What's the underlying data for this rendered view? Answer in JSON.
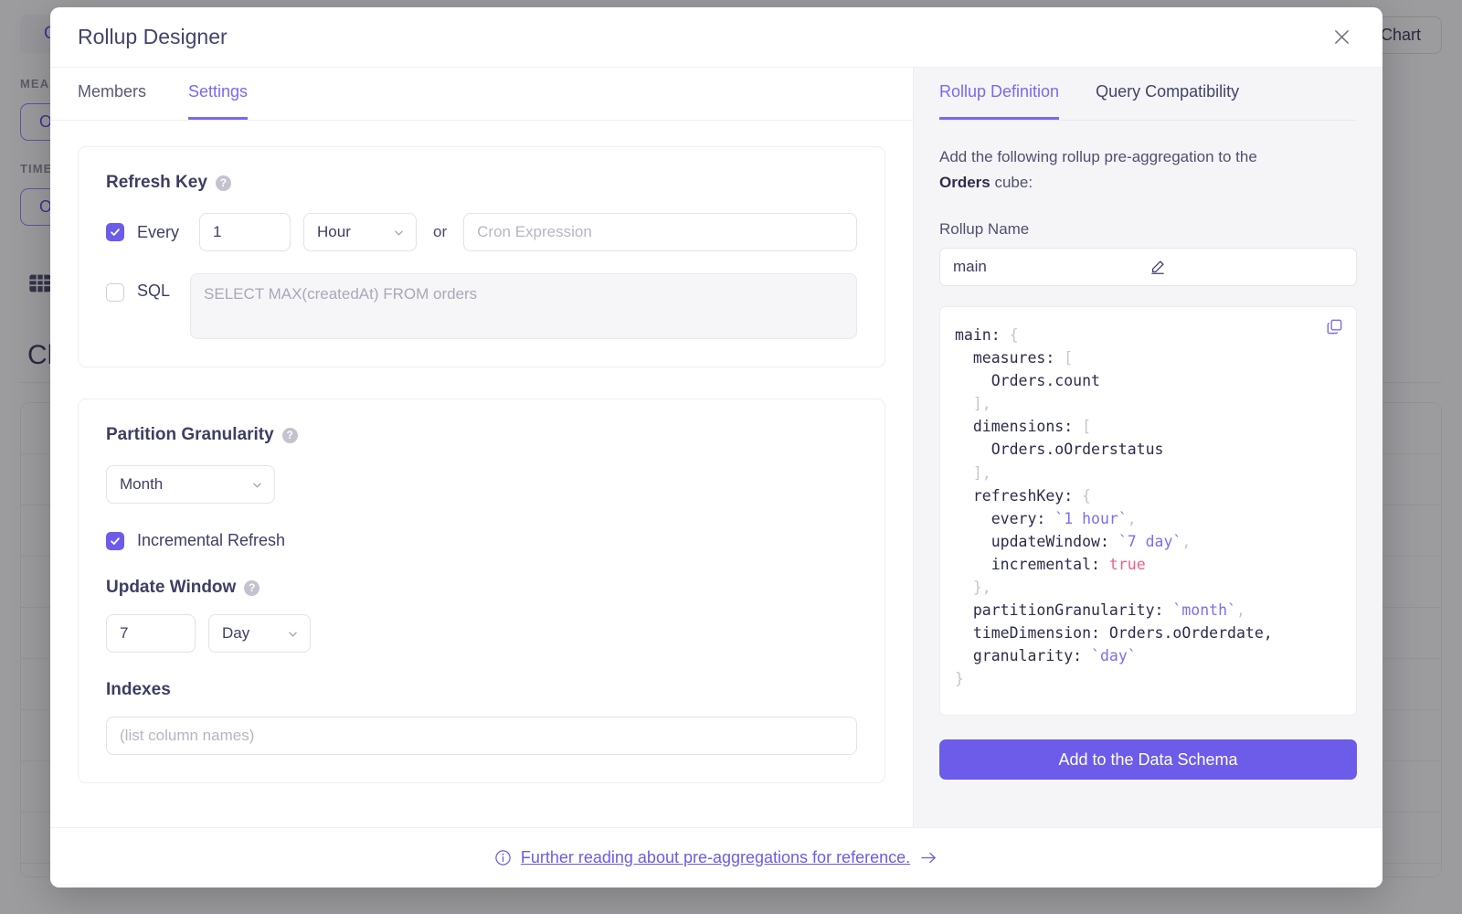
{
  "background": {
    "tab_label": "Query",
    "right_button_label": "Chart",
    "measures_label": "MEASURES",
    "measures_chip": "Orders.count",
    "time_label": "TIME DIMENSION",
    "time_chip": "Orders.oOrderdate",
    "grid_icon": "grid-icon",
    "heading": "Chart"
  },
  "modal": {
    "title": "Rollup Designer",
    "close_icon": "close-icon"
  },
  "left": {
    "tabs": [
      {
        "label": "Members",
        "active": false
      },
      {
        "label": "Settings",
        "active": true
      }
    ],
    "refresh_key": {
      "title": "Refresh Key",
      "help_icon": "help-icon",
      "every": {
        "checked": true,
        "label": "Every",
        "value": "1",
        "unit": "Hour",
        "or_label": "or",
        "cron_placeholder": "Cron Expression",
        "cron_value": ""
      },
      "sql": {
        "checked": false,
        "label": "SQL",
        "placeholder": "SELECT MAX(createdAt) FROM orders",
        "value": ""
      }
    },
    "partition": {
      "title": "Partition Granularity",
      "help_icon": "help-icon",
      "granularity": "Month",
      "incremental": {
        "checked": true,
        "label": "Incremental Refresh"
      },
      "update_window": {
        "title": "Update Window",
        "help_icon": "help-icon",
        "value": "7",
        "unit": "Day"
      },
      "indexes": {
        "title": "Indexes",
        "placeholder": "(list column names)",
        "value": ""
      }
    }
  },
  "right": {
    "tabs": [
      {
        "label": "Rollup Definition",
        "active": true
      },
      {
        "label": "Query Compatibility",
        "active": false
      }
    ],
    "description_pre": "Add the following rollup pre-aggregation to the ",
    "description_bold": "Orders",
    "description_post": " cube:",
    "rollup_name_label": "Rollup Name",
    "rollup_name_value": "main",
    "edit_icon": "pencil-edit-icon",
    "copy_icon": "copy-icon",
    "code": {
      "l1": "main: ",
      "l1b": "{",
      "l2": "  measures: ",
      "l2b": "[",
      "l3": "    Orders.count",
      "l4b": "  ],",
      "l5": "  dimensions: ",
      "l5b": "[",
      "l6": "    Orders.oOrderstatus",
      "l7b": "  ],",
      "l8": "  refreshKey: ",
      "l8b": "{",
      "l9": "    every: ",
      "l9t": "`1 hour`",
      "l9c": ",",
      "l10": "    updateWindow: ",
      "l10t": "`7 day`",
      "l10c": ",",
      "l11": "    incremental: ",
      "l11v": "true",
      "l12b": "  },",
      "l13": "  partitionGranularity: ",
      "l13t": "`month`",
      "l13c": ",",
      "l14": "  timeDimension: Orders.oOrderdate,",
      "l15": "  granularity: ",
      "l15t": "`day`",
      "l16b": "}"
    },
    "add_button_label": "Add to the Data Schema"
  },
  "footer": {
    "info_icon": "info-circle-icon",
    "link_text": "Further reading about pre-aggregations for reference.",
    "arrow_icon": "arrow-right-icon"
  },
  "colors": {
    "accent": "#6c5ce9",
    "accent_light": "#7a68f5",
    "text": "#3e3e63",
    "panel_bg": "#f5f5f8",
    "bool": "#ef5f8a"
  }
}
